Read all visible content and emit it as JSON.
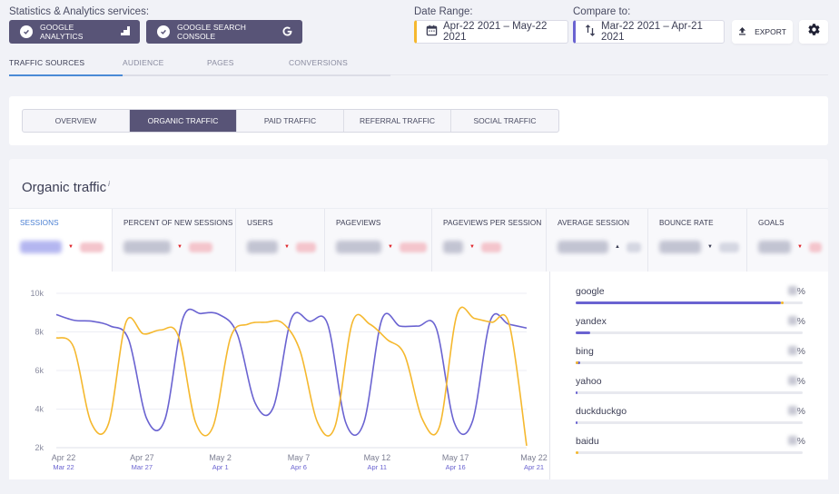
{
  "header": {
    "services_label": "Statistics & Analytics services:",
    "services": [
      {
        "label": "GOOGLE ANALYTICS",
        "icon": "google-analytics-icon",
        "checked": true
      },
      {
        "label": "GOOGLE SEARCH CONSOLE",
        "icon": "google-g-icon",
        "checked": true
      }
    ],
    "date_range": {
      "label": "Date Range:",
      "value": "Apr-22 2021 – May-22 2021",
      "icon": "calendar-icon",
      "accent": "#f5b82e"
    },
    "compare_to": {
      "label": "Compare to:",
      "value": "Mar-22 2021 – Apr-21 2021",
      "icon": "swap-arrows-icon",
      "accent": "#6a63d1"
    },
    "export_label": "EXPORT",
    "settings_icon": "gear-icon"
  },
  "top_tabs": [
    {
      "label": "TRAFFIC SOURCES",
      "active": true
    },
    {
      "label": "AUDIENCE",
      "active": false
    },
    {
      "label": "PAGES",
      "active": false
    },
    {
      "label": "CONVERSIONS",
      "active": false
    }
  ],
  "sub_tabs": [
    {
      "label": "OVERVIEW",
      "active": false
    },
    {
      "label": "ORGANIC TRAFFIC",
      "active": true
    },
    {
      "label": "PAID TRAFFIC",
      "active": false
    },
    {
      "label": "REFERRAL TRAFFIC",
      "active": false
    },
    {
      "label": "SOCIAL TRAFFIC",
      "active": false
    }
  ],
  "card": {
    "title": "Organic traffic",
    "info_marker": "i"
  },
  "kpis": [
    {
      "label": "SESSIONS",
      "active": true,
      "value": "(blurred)",
      "trend": "down"
    },
    {
      "label": "PERCENT OF NEW SESSIONS",
      "active": false,
      "value": "(blurred)",
      "trend": "down"
    },
    {
      "label": "USERS",
      "active": false,
      "value": "(blurred)",
      "trend": "down"
    },
    {
      "label": "PAGEVIEWS",
      "active": false,
      "value": "(blurred)",
      "trend": "down"
    },
    {
      "label": "PAGEVIEWS PER SESSION",
      "active": false,
      "value": "(blurred)",
      "trend": "down"
    },
    {
      "label": "AVERAGE SESSION",
      "active": false,
      "value": "(blurred)",
      "trend": "up"
    },
    {
      "label": "BOUNCE RATE",
      "active": false,
      "value": "(blurred)",
      "trend": "down-neutral"
    },
    {
      "label": "GOALS",
      "active": false,
      "value": "(blurred)",
      "trend": "down"
    }
  ],
  "colors": {
    "primary_series": "#6a63d1",
    "compare_series": "#f5b82e",
    "active_tab": "#585477",
    "active_tab_underline": "#4a8ad6",
    "trend_down": "#e0262c"
  },
  "chart_data": {
    "type": "line",
    "title": "",
    "xlabel": "",
    "ylabel": "",
    "ylim": [
      2000,
      10000
    ],
    "yticks": [
      "2k",
      "4k",
      "6k",
      "8k",
      "10k"
    ],
    "grid": true,
    "x_ticks_primary": [
      "Apr 22",
      "Apr 27",
      "May 2",
      "May 7",
      "May 12",
      "May 17",
      "May 22"
    ],
    "x_ticks_compare": [
      "Mar 22",
      "Mar 27",
      "Apr 1",
      "Apr 6",
      "Apr 11",
      "Apr 16",
      "Apr 21"
    ],
    "x_days": 30,
    "series": [
      {
        "name": "Apr-22 2021 – May-22 2021",
        "color": "#6a63d1",
        "values": [
          8900,
          8600,
          8550,
          8300,
          7600,
          3500,
          3450,
          8700,
          8950,
          8900,
          7900,
          4300,
          4100,
          8700,
          8550,
          8400,
          3300,
          3300,
          8650,
          8300,
          8300,
          8200,
          3300,
          3350,
          8600,
          8400,
          8200
        ]
      },
      {
        "name": "Mar-22 2021 – Apr-21 2021",
        "color": "#f5b82e",
        "values": [
          7700,
          7200,
          3300,
          3250,
          8500,
          7900,
          8100,
          7800,
          3300,
          3100,
          7700,
          8400,
          8500,
          8450,
          7000,
          3300,
          3100,
          8500,
          8400,
          7600,
          6800,
          3500,
          3100,
          8900,
          8700,
          8500,
          8400,
          2100
        ]
      }
    ]
  },
  "sources": [
    {
      "name": "google",
      "pct_label": "%",
      "share": 0.99,
      "compare_share": 0.99
    },
    {
      "name": "yandex",
      "pct_label": "%",
      "share": 0.07,
      "compare_share": null
    },
    {
      "name": "bing",
      "pct_label": "%",
      "share": 0.02,
      "compare_share": 0.005
    },
    {
      "name": "yahoo",
      "pct_label": "%",
      "share": 0.005,
      "compare_share": null
    },
    {
      "name": "duckduckgo",
      "pct_label": "%",
      "share": 0.003,
      "compare_share": null
    },
    {
      "name": "baidu",
      "pct_label": "%",
      "share": 0.0,
      "compare_share": 0.005
    }
  ]
}
